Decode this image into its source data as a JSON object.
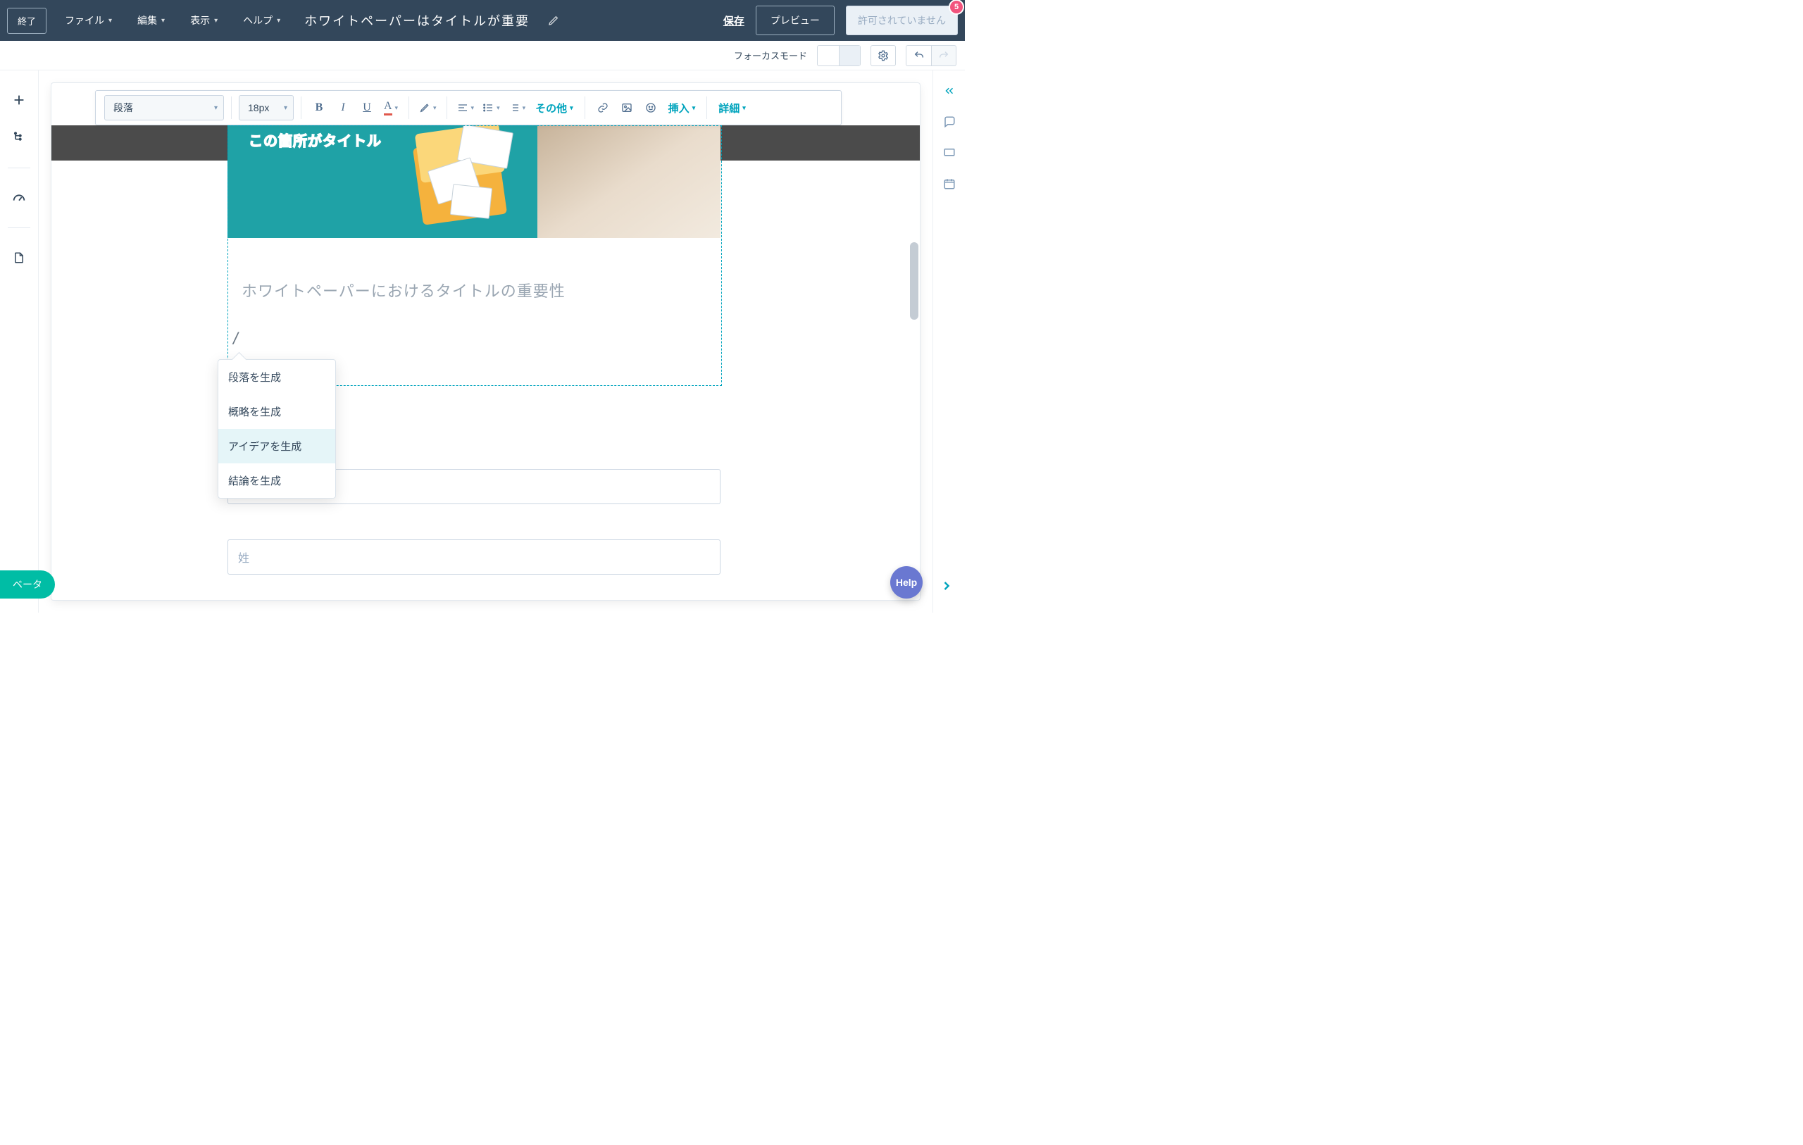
{
  "topbar": {
    "exit": "終了",
    "menus": {
      "file": "ファイル",
      "edit": "編集",
      "view": "表示",
      "help": "ヘルプ"
    },
    "doc_title": "ホワイトペーパーはタイトルが重要",
    "save": "保存",
    "preview": "プレビュー",
    "disabled": "許可されていません",
    "badge": "5"
  },
  "subbar": {
    "focus_mode_label": "フォーカスモード"
  },
  "rte": {
    "style_select": "段落",
    "size_select": "18px",
    "other": "その他",
    "insert": "挿入",
    "advanced": "詳細"
  },
  "hero": {
    "title_overlay": "この箇所がタイトル"
  },
  "content": {
    "heading_placeholder": "ホワイトペーパーにおけるタイトルの重要性",
    "slash": "/"
  },
  "popup": {
    "items": [
      "段落を生成",
      "概略を生成",
      "アイデアを生成",
      "結論を生成"
    ],
    "hover_index": 2
  },
  "form": {
    "field_last_name": "姓"
  },
  "beta": "ベータ",
  "help": "Help"
}
